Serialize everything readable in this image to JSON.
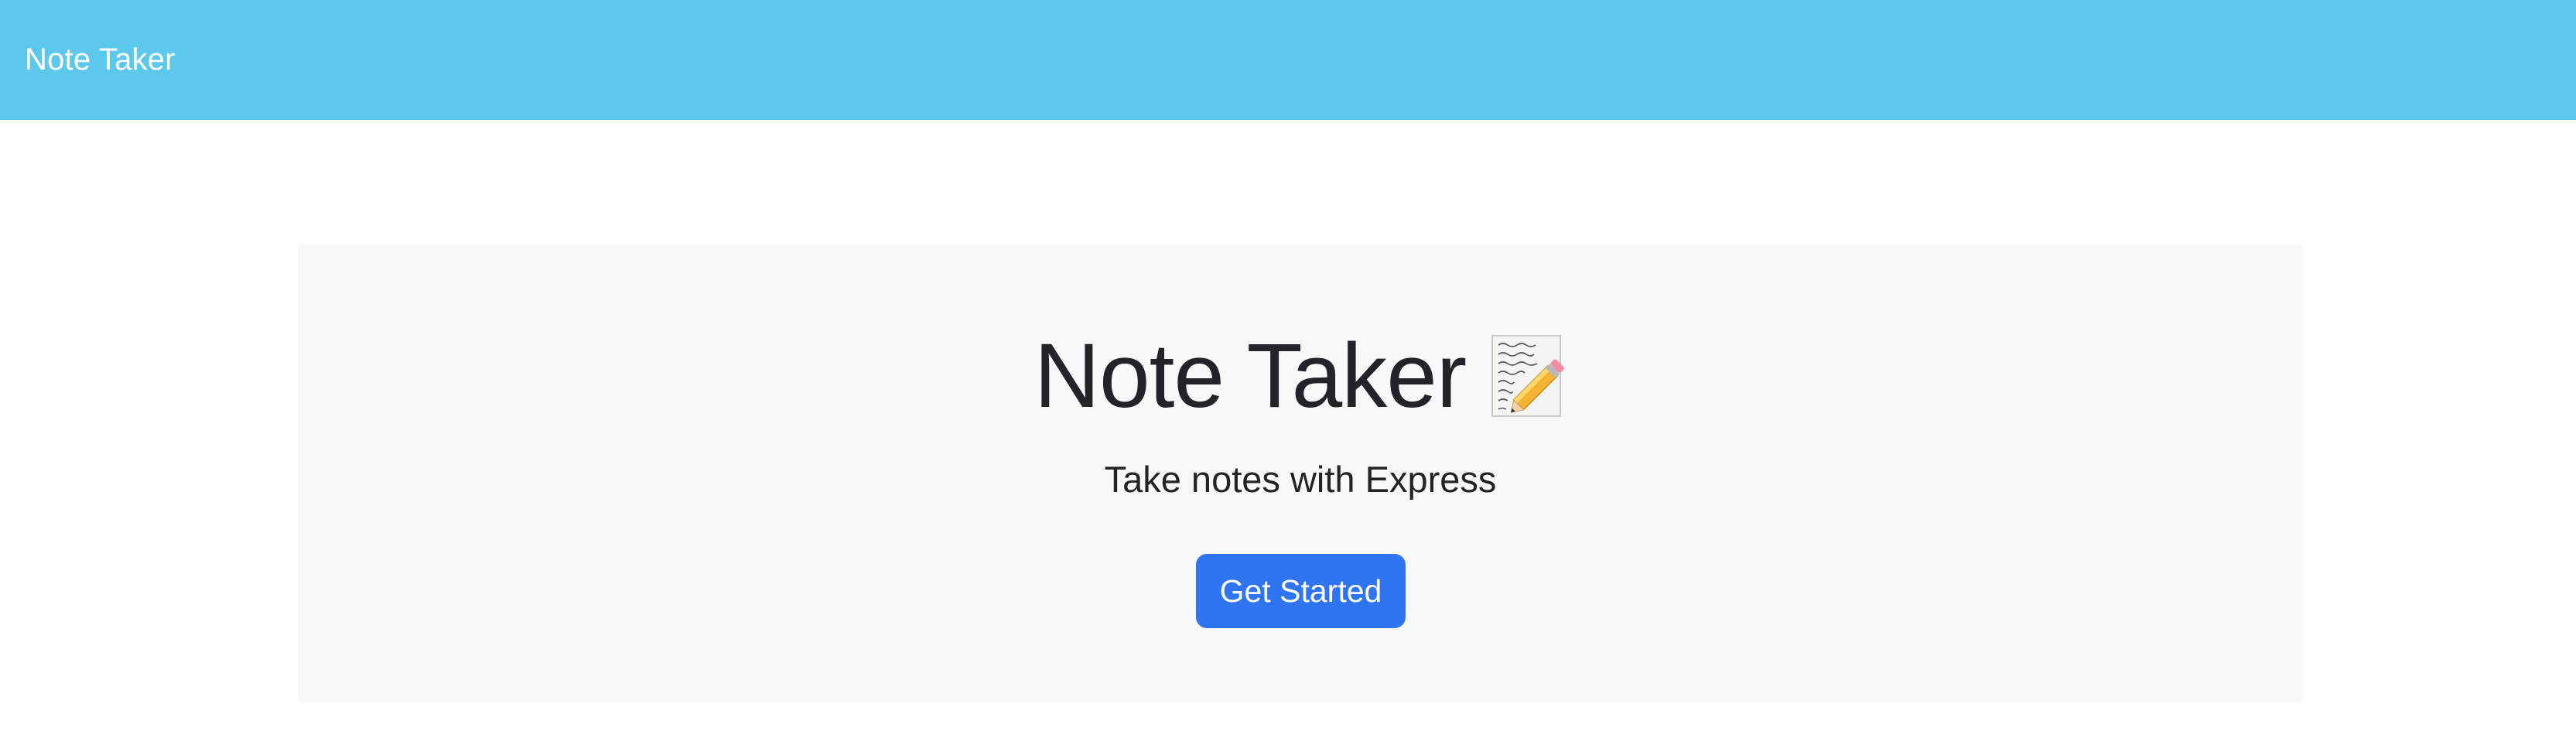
{
  "navbar": {
    "brand": "Note Taker",
    "background_color": "#5bc8ec"
  },
  "hero": {
    "title": "Note Taker",
    "title_icon": "memo-pencil-icon",
    "subtitle": "Take notes with Express",
    "cta_label": "Get Started",
    "cta_color": "#2f74f0",
    "panel_color": "#f7f8f9"
  }
}
